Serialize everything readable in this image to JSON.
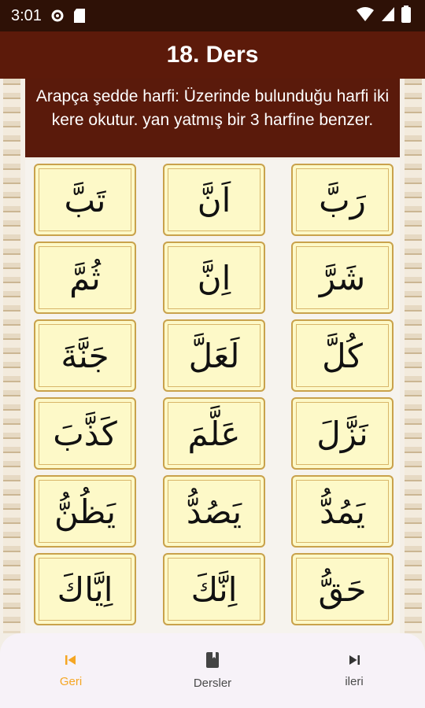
{
  "status_bar": {
    "time": "3:01"
  },
  "app_bar": {
    "title": "18. Ders"
  },
  "info": {
    "text": "Arapça şedde harfi: Üzerinde bulunduğu harfi iki kere okutur. yan yatmış bir 3 harfine benzer."
  },
  "columns": [
    [
      "تَبَّ",
      "ثُمَّ",
      "جَنَّةَ",
      "كَذَّبَ",
      "يَظُنُّ",
      "اِيَّاكَ"
    ],
    [
      "اَنَّ",
      "اِنَّ",
      "لَعَلَّ",
      "عَلَّمَ",
      "يَصُدُّ",
      "اِنَّكَ"
    ],
    [
      "رَبَّ",
      "شَرَّ",
      "كُلَّ",
      "نَزَّلَ",
      "يَمُدُّ",
      "حَقُّ"
    ]
  ],
  "bottom_nav": [
    {
      "label": "Geri",
      "icon": "skip-previous-icon",
      "active": true
    },
    {
      "label": "Dersler",
      "icon": "book-icon",
      "active": false
    },
    {
      "label": "ileri",
      "icon": "skip-next-icon",
      "active": false
    }
  ],
  "colors": {
    "app_bar": "#5c1a0a",
    "accent": "#f5a623",
    "card": "#fdf9c8"
  }
}
